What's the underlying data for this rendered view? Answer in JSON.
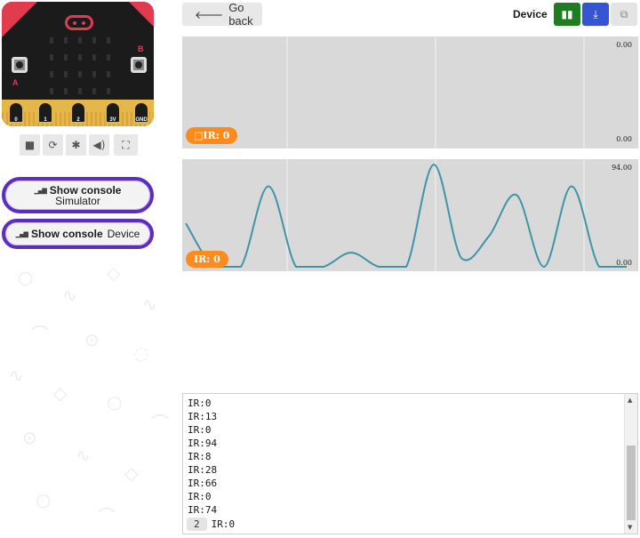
{
  "simulator": {
    "pins": [
      "0",
      "1",
      "2",
      "3V",
      "GND"
    ],
    "button_a": "A",
    "button_b": "B",
    "toolbar": {
      "stop_icon": "stop-icon",
      "restart_icon": "restart-icon",
      "debug_icon": "bug-icon",
      "sound_icon": "speaker-icon",
      "fullscreen_icon": "fullscreen-icon"
    }
  },
  "console_buttons": {
    "simulator": {
      "title": "Show console",
      "sub": "Simulator"
    },
    "device": {
      "title": "Show console",
      "sub": "Device"
    }
  },
  "header": {
    "go_back": "Go back",
    "device_label": "Device",
    "buttons": [
      "split-view-icon",
      "download-icon",
      "copy-icon"
    ]
  },
  "colors": {
    "accent_purple": "#5c2dbf",
    "tag_orange": "#ff8b1e",
    "line_teal": "#3d95a8",
    "btn_green": "#1e7d1e",
    "btn_blue": "#3454d1"
  },
  "charts": [
    {
      "tag": "□IR: 0",
      "ymax_label": "0.00",
      "ymin_label": "0.00"
    },
    {
      "tag": "IR: 0",
      "ymax_label": "94.00",
      "ymin_label": "0.00"
    }
  ],
  "chart_data": [
    {
      "type": "line",
      "series": [
        {
          "name": "□IR",
          "values": []
        }
      ],
      "ylim": [
        0,
        0
      ]
    },
    {
      "type": "line",
      "series": [
        {
          "name": "IR",
          "values": [
            40,
            0,
            0,
            74,
            0,
            0,
            13,
            0,
            0,
            94,
            8,
            28,
            66,
            0,
            74,
            0,
            0
          ]
        }
      ],
      "ylim": [
        0,
        94
      ]
    }
  ],
  "console": {
    "lines": [
      "IR:0",
      "IR:13",
      "IR:0",
      "IR:94",
      "IR:8",
      "IR:28",
      "IR:66",
      "IR:0",
      "IR:74"
    ],
    "last_count": "2",
    "last_line": "IR:0"
  }
}
